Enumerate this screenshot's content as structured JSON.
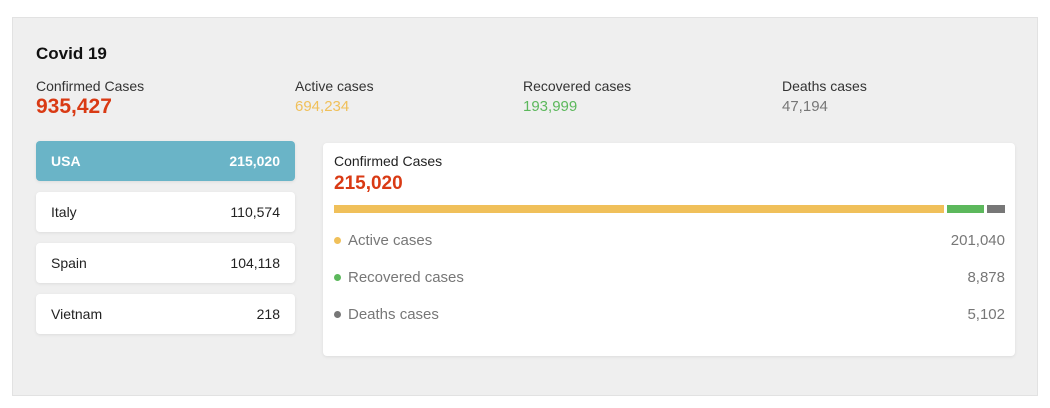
{
  "colors": {
    "confirmed": "#d93a14",
    "active": "#f0c05a",
    "recovered": "#5cb85c",
    "deaths": "#777777",
    "selected": "#6ab4c7"
  },
  "header": {
    "title": "Covid 19"
  },
  "stats": {
    "confirmed": {
      "label": "Confirmed Cases",
      "value": "935,427"
    },
    "active": {
      "label": "Active cases",
      "value": "694,234"
    },
    "recovered": {
      "label": "Recovered cases",
      "value": "193,999"
    },
    "deaths": {
      "label": "Deaths cases",
      "value": "47,194"
    }
  },
  "countries": [
    {
      "name": "USA",
      "value": "215,020"
    },
    {
      "name": "Italy",
      "value": "110,574"
    },
    {
      "name": "Spain",
      "value": "104,118"
    },
    {
      "name": "Vietnam",
      "value": "218"
    }
  ],
  "detail": {
    "label": "Confirmed Cases",
    "value": "215,020",
    "breakdown": {
      "active": {
        "label": "Active cases",
        "value": "201,040",
        "count": 201040
      },
      "recovered": {
        "label": "Recovered cases",
        "value": "8,878",
        "count": 8878
      },
      "deaths": {
        "label": "Deaths cases",
        "value": "5,102",
        "count": 5102
      }
    }
  }
}
